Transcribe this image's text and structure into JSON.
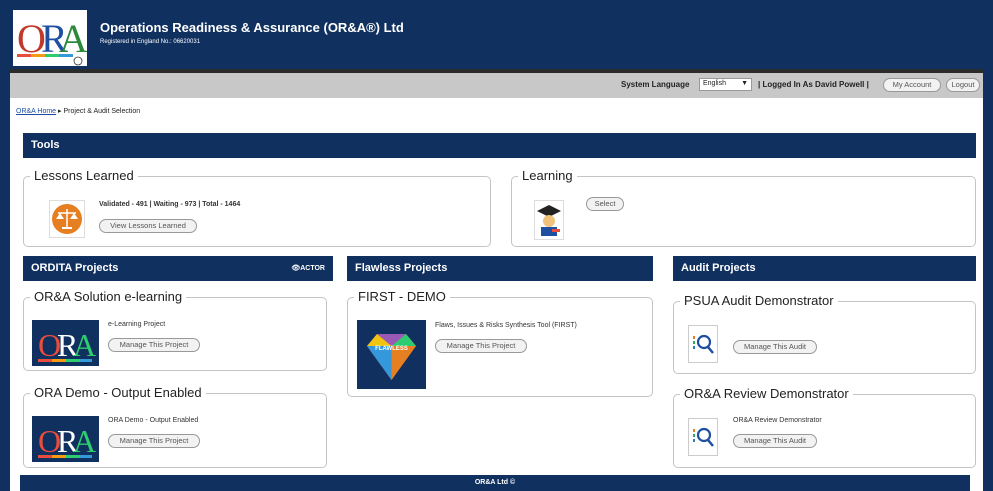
{
  "header": {
    "title": "Operations Readiness & Assurance (OR&A®) Ltd",
    "registration": "Registered in England No.: 06620031",
    "logo_text": "ORA"
  },
  "userbar": {
    "language_label": "System Language",
    "language_value": "English",
    "logged_in": "| Logged In As David Powell |",
    "my_account": "My Account",
    "logout": "Logout"
  },
  "breadcrumb": {
    "home": "OR&A Home",
    "current": "▸ Project & Audit Selection"
  },
  "tools": {
    "title": "Tools",
    "lessons": {
      "legend": "Lessons Learned",
      "stats": "Validated - 491 | Waiting - 973 | Total - 1464",
      "button": "View Lessons Learned"
    },
    "learning": {
      "legend": "Learning",
      "button": "Select"
    }
  },
  "ordita": {
    "title": "ORDITA Projects",
    "actor": "👁ACTOR",
    "projects": [
      {
        "legend": "OR&A Solution e-learning",
        "desc": "e-Learning Project",
        "button": "Manage This Project"
      },
      {
        "legend": "ORA Demo - Output Enabled",
        "desc": "ORA Demo - Output Enabled",
        "button": "Manage This Project"
      }
    ]
  },
  "flawless": {
    "title": "Flawless Projects",
    "projects": [
      {
        "legend": "FIRST - DEMO",
        "desc": "Flaws, Issues & Risks Synthesis Tool (FIRST)",
        "button": "Manage This Project",
        "thumb_text": "FLAWLESS"
      }
    ]
  },
  "audit": {
    "title": "Audit Projects",
    "projects": [
      {
        "legend": "PSUA Audit Demonstrator",
        "desc": "",
        "button": "Manage This Audit"
      },
      {
        "legend": "OR&A Review Demonstrator",
        "desc": "OR&A Review Demonstrator",
        "button": "Manage This Audit"
      }
    ]
  },
  "footer": {
    "text": "OR&A Ltd ©"
  },
  "colors": {
    "navy": "#10305f",
    "gray_bar": "#c8c8c8"
  }
}
